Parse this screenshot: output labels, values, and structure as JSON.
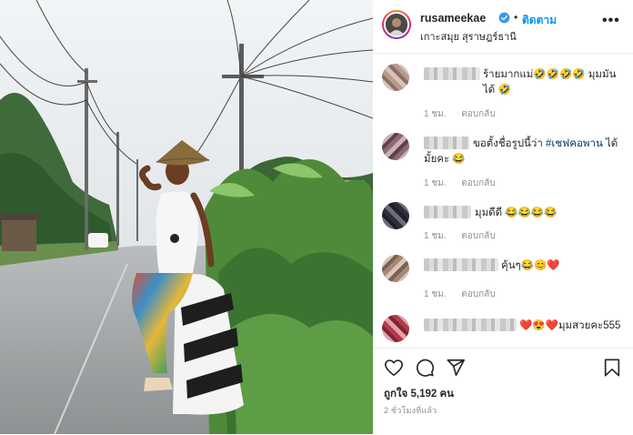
{
  "post": {
    "username": "rusameekae",
    "follow_label": "ติดตาม",
    "location": "เกาะสมุย สุราษฎร์ธานี",
    "more_label": "•••"
  },
  "comments": [
    {
      "text": "ร้ายมากแม่🤣🤣🤣🤣 มุมมันได้ 🤣",
      "time": "1 ชม.",
      "reply": "ตอบกลับ"
    },
    {
      "text_before": "ขอตั้งชื่อรูปนี้ว่า",
      "hashtag": "#เชฟคอพาน",
      "text_after": "ได้มั้ยคะ 😂",
      "time": "1 ชม.",
      "reply": "ตอบกลับ"
    },
    {
      "text": "มุมดีดี 😂😂😂😂",
      "time": "1 ชม.",
      "reply": "ตอบกลับ"
    },
    {
      "text": "คุ้นๆ😂😊❤️",
      "time": "1 ชม.",
      "reply": "ตอบกลับ"
    },
    {
      "text": "❤️😍❤️มุมสวยคะ555",
      "time": "",
      "reply": ""
    }
  ],
  "footer": {
    "likes": "ถูกใจ 5,192 คน",
    "time_ago": "2 ชั่วโมงที่แล้ว"
  },
  "icons": [
    "verified-badge-icon",
    "heart-icon",
    "comment-icon",
    "share-icon",
    "bookmark-icon"
  ],
  "colors": {
    "accent": "#0095f6",
    "verified": "#3897f0",
    "muted": "#8e8e8e",
    "text": "#262626"
  }
}
